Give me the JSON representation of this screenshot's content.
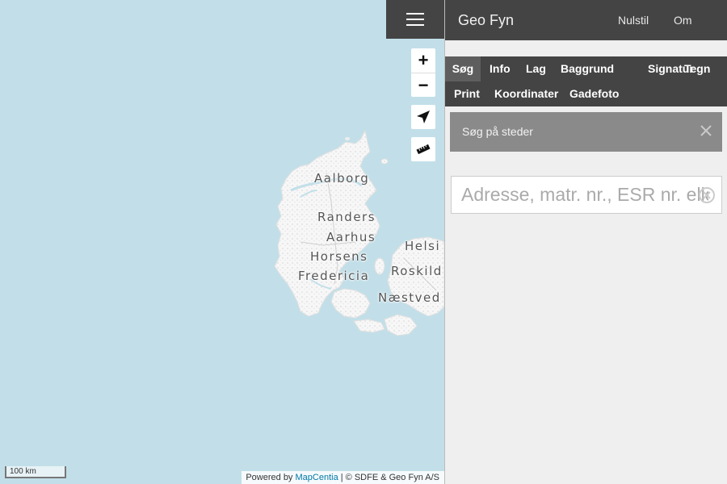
{
  "app": {
    "title": "Geo Fyn"
  },
  "header": {
    "reset_label": "Nulstil",
    "about_label": "Om"
  },
  "tabs": [
    {
      "label": "Søg",
      "active": true
    },
    {
      "label": "Info"
    },
    {
      "label": "Lag"
    },
    {
      "label": "Baggrund"
    },
    {
      "label": "Signatur"
    },
    {
      "label": "Tegn"
    },
    {
      "label": "Print"
    },
    {
      "label": "Koordinater"
    },
    {
      "label": "Gadefoto"
    }
  ],
  "search": {
    "header_label": "Søg på steder",
    "placeholder": "Adresse, matr. nr., ESR nr. eller",
    "value": ""
  },
  "map": {
    "cities": [
      "Aalborg",
      "Randers",
      "Aarhus",
      "Horsens",
      "Fredericia",
      "Næstved",
      "Helsi",
      "Roskild"
    ],
    "scale_label": "100 km",
    "attribution": {
      "prefix": "Powered by",
      "link": "MapCentia",
      "suffix": "| © SDFE & Geo Fyn A/S"
    },
    "controls": {
      "zoom_in": "+",
      "zoom_out": "−"
    }
  },
  "icons": {
    "menu": "hamburger-icon",
    "locate": "location-arrow-icon",
    "measure": "ruler-icon",
    "close": "close-icon",
    "clear": "clear-circle-icon"
  },
  "colors": {
    "header_bg": "#444444",
    "active_tab_bg": "#5e5e5e",
    "sea": "#c2dfe9",
    "land": "#f4f4f4",
    "link": "#0078a8"
  }
}
